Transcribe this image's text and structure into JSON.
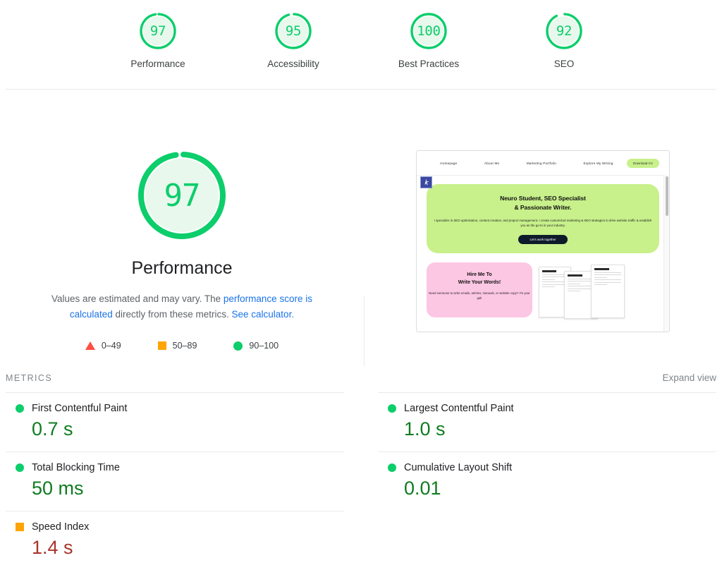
{
  "top_scores": [
    {
      "value": "97",
      "label": "Performance",
      "pct": 97,
      "color": "#0cce6b"
    },
    {
      "value": "95",
      "label": "Accessibility",
      "pct": 95,
      "color": "#0cce6b"
    },
    {
      "value": "100",
      "label": "Best Practices",
      "pct": 100,
      "color": "#0cce6b"
    },
    {
      "value": "92",
      "label": "SEO",
      "pct": 92,
      "color": "#0cce6b"
    }
  ],
  "performance": {
    "score": "97",
    "title": "Performance",
    "desc_part1": "Values are estimated and may vary. The ",
    "link1": "performance score is calculated",
    "desc_part2": " directly from these metrics. ",
    "link2": "See calculator.",
    "gauge_color": "#0cce6b",
    "gauge_fill": "#e8f8ed"
  },
  "legend": [
    {
      "shape": "triangle",
      "range": "0–49",
      "color": "#ff4e42"
    },
    {
      "shape": "square",
      "range": "50–89",
      "color": "#ffa400"
    },
    {
      "shape": "circle",
      "range": "90–100",
      "color": "#0cce6b"
    }
  ],
  "thumbnail": {
    "nav_items": [
      "Homepage",
      "About Me",
      "Marketing Portfolio",
      "Explore My Writing"
    ],
    "cta_button": "Download CV",
    "hero_line1": "Neuro Student, SEO Specialist",
    "hero_line2": "& Passionate Writer.",
    "hero_paragraph": "I specialize in SEO optimization, content creation, and project management. I create customized marketing & SEO strategies to drive website traffic & establish you as the go-to in your industry.",
    "hero_button": "Let's work together",
    "card_title_line1": "Hire Me To",
    "card_title_line2": "Write Your Words!",
    "card_paragraph": "Need someone to write emails, articles, manuals, or website copy? I'm your gal!",
    "accessibility_widget": "accessibility-icon"
  },
  "metrics_section": {
    "title": "METRICS",
    "expand_label": "Expand view"
  },
  "metrics": [
    {
      "name": "First Contentful Paint",
      "value": "0.7 s",
      "status": "pass",
      "marker": "circle"
    },
    {
      "name": "Largest Contentful Paint",
      "value": "1.0 s",
      "status": "pass",
      "marker": "circle"
    },
    {
      "name": "Total Blocking Time",
      "value": "50 ms",
      "status": "pass",
      "marker": "circle"
    },
    {
      "name": "Cumulative Layout Shift",
      "value": "0.01",
      "status": "pass",
      "marker": "circle"
    },
    {
      "name": "Speed Index",
      "value": "1.4 s",
      "status": "average",
      "marker": "square"
    }
  ]
}
